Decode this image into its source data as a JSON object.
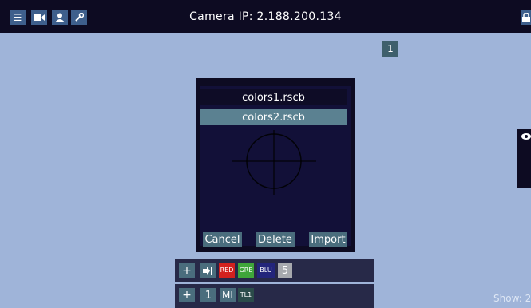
{
  "header": {
    "title": "Camera IP: 2.188.200.134",
    "buttons": [
      {
        "icon": "sliders-icon",
        "glyph": "☰"
      },
      {
        "icon": "video-camera-icon",
        "glyph": "■"
      },
      {
        "icon": "user-icon",
        "glyph": "●"
      },
      {
        "icon": "wrench-icon",
        "glyph": "✎"
      }
    ],
    "lock_icon": "lock-icon"
  },
  "badge": "1",
  "dialog": {
    "files": [
      "colors1.rscb",
      "colors2.rscb"
    ],
    "selected_index": 1,
    "buttons": {
      "cancel": "Cancel",
      "delete": "Delete",
      "import": "Import"
    }
  },
  "toolbar1": {
    "add": "+",
    "login_icon": "sign-in-icon",
    "red": "RED",
    "green": "GRE",
    "blue": "BLU",
    "value": "5"
  },
  "toolbar2": {
    "add": "+",
    "one": "1",
    "mi": "MI",
    "tl": "TL1"
  },
  "footer": {
    "show": "Show: 2"
  },
  "colors": {
    "background": "#9fb4d9",
    "panel": "#0d0b22",
    "accent": "#3e5f8c",
    "selected": "#5b8191",
    "red": "#d2211e",
    "green": "#3fa63a",
    "blue": "#23257b"
  }
}
